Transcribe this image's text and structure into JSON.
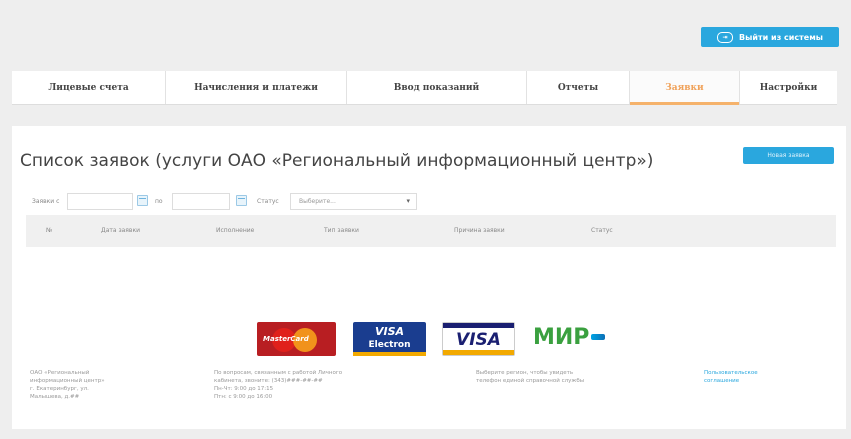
{
  "header": {
    "logout_label": "Выйти из системы",
    "logout_icon": "logout-icon"
  },
  "nav": {
    "tabs": [
      {
        "label": "Лицевые счета"
      },
      {
        "label": "Начисления и платежи"
      },
      {
        "label": "Ввод показаний"
      },
      {
        "label": "Отчеты"
      },
      {
        "label": "Заявки",
        "active": true
      },
      {
        "label": "Настройки"
      }
    ]
  },
  "main": {
    "title": "Список заявок (услуги ОАО «Региональный информационный центр»)",
    "new_request_button": "Новая заявка",
    "filters": {
      "from_label": "Заявки с",
      "to_label": "по",
      "status_label": "Статус",
      "status_value": "Выберите..."
    },
    "table": {
      "columns": [
        "№",
        "Дата заявки",
        "Исполнение",
        "Тип заявки",
        "Причина заявки",
        "Статус"
      ]
    }
  },
  "payment_logos": {
    "mastercard": "MasterCard",
    "visa_electron_top": "VISA",
    "visa_electron_bottom": "Electron",
    "visa": "VISA",
    "mir": "МИР"
  },
  "footer": {
    "company_lines": [
      "ОАО «Региональный",
      "информационный центр»",
      "г. Екатеринбург, ул.",
      "Малышева, д.##"
    ],
    "support_lines": [
      "По вопросам, связанным с работой Личного",
      "кабинета, звоните: (343)###-##-##",
      "Пн-Чт: 9:00 до 17:15",
      "Птн: с 9:00 до 16:00"
    ],
    "apps_lines": [
      "Выберите регион, чтобы увидеть",
      "телефон единой справочной службы"
    ],
    "link_lines": [
      "Пользовательское",
      "соглашение"
    ]
  },
  "colors": {
    "accent": "#2aa7de",
    "active_tab": "#f0a25a",
    "background": "#eeeeee"
  }
}
